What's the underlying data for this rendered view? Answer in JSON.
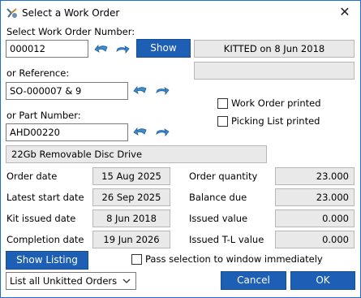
{
  "window": {
    "title": "Select a Work Order",
    "close_glyph": "✕"
  },
  "labels": {
    "select_number": "Select Work Order Number:",
    "or_reference": "or Reference:",
    "or_part": "or Part Number:",
    "order_date": "Order date",
    "latest_start": "Latest start date",
    "kit_issued": "Kit issued date",
    "completion": "Completion date",
    "order_qty": "Order quantity",
    "balance_due": "Balance due",
    "issued_value": "Issued value",
    "issued_tl": "Issued T-L value"
  },
  "inputs": {
    "work_order_number": "000012",
    "reference": "SO-000007 & 9",
    "part_number": "AHD00220"
  },
  "buttons": {
    "show": "Show",
    "show_listing": "Show Listing",
    "cancel": "Cancel",
    "ok": "OK"
  },
  "status": {
    "kitted": "KITTED on 8 Jun 2018",
    "blank": "",
    "part_description": "22Gb Removable Disc Drive"
  },
  "checkboxes": {
    "wo_printed": "Work Order printed",
    "picking_printed": "Picking List printed",
    "pass_selection": "Pass selection to window immediately"
  },
  "values": {
    "order_date": "15 Aug 2025",
    "latest_start": "26 Sep 2025",
    "kit_issued": "8 Jun 2018",
    "completion": "19 Jun 2026",
    "order_qty": "23.000",
    "balance_due": "23.000",
    "issued_value": "0.000",
    "issued_tl": "0.000"
  },
  "dropdown": {
    "selected": "List all Unkitted Orders"
  },
  "icons": [
    "app-icon",
    "back-arrow-icon",
    "forward-arrow-icon",
    "chevron-down-icon"
  ],
  "colors": {
    "accent": "#1c5fb5",
    "border": "#1f6fd0",
    "readonly": "#e9e9e9",
    "arrow": "#3b8ed6"
  }
}
